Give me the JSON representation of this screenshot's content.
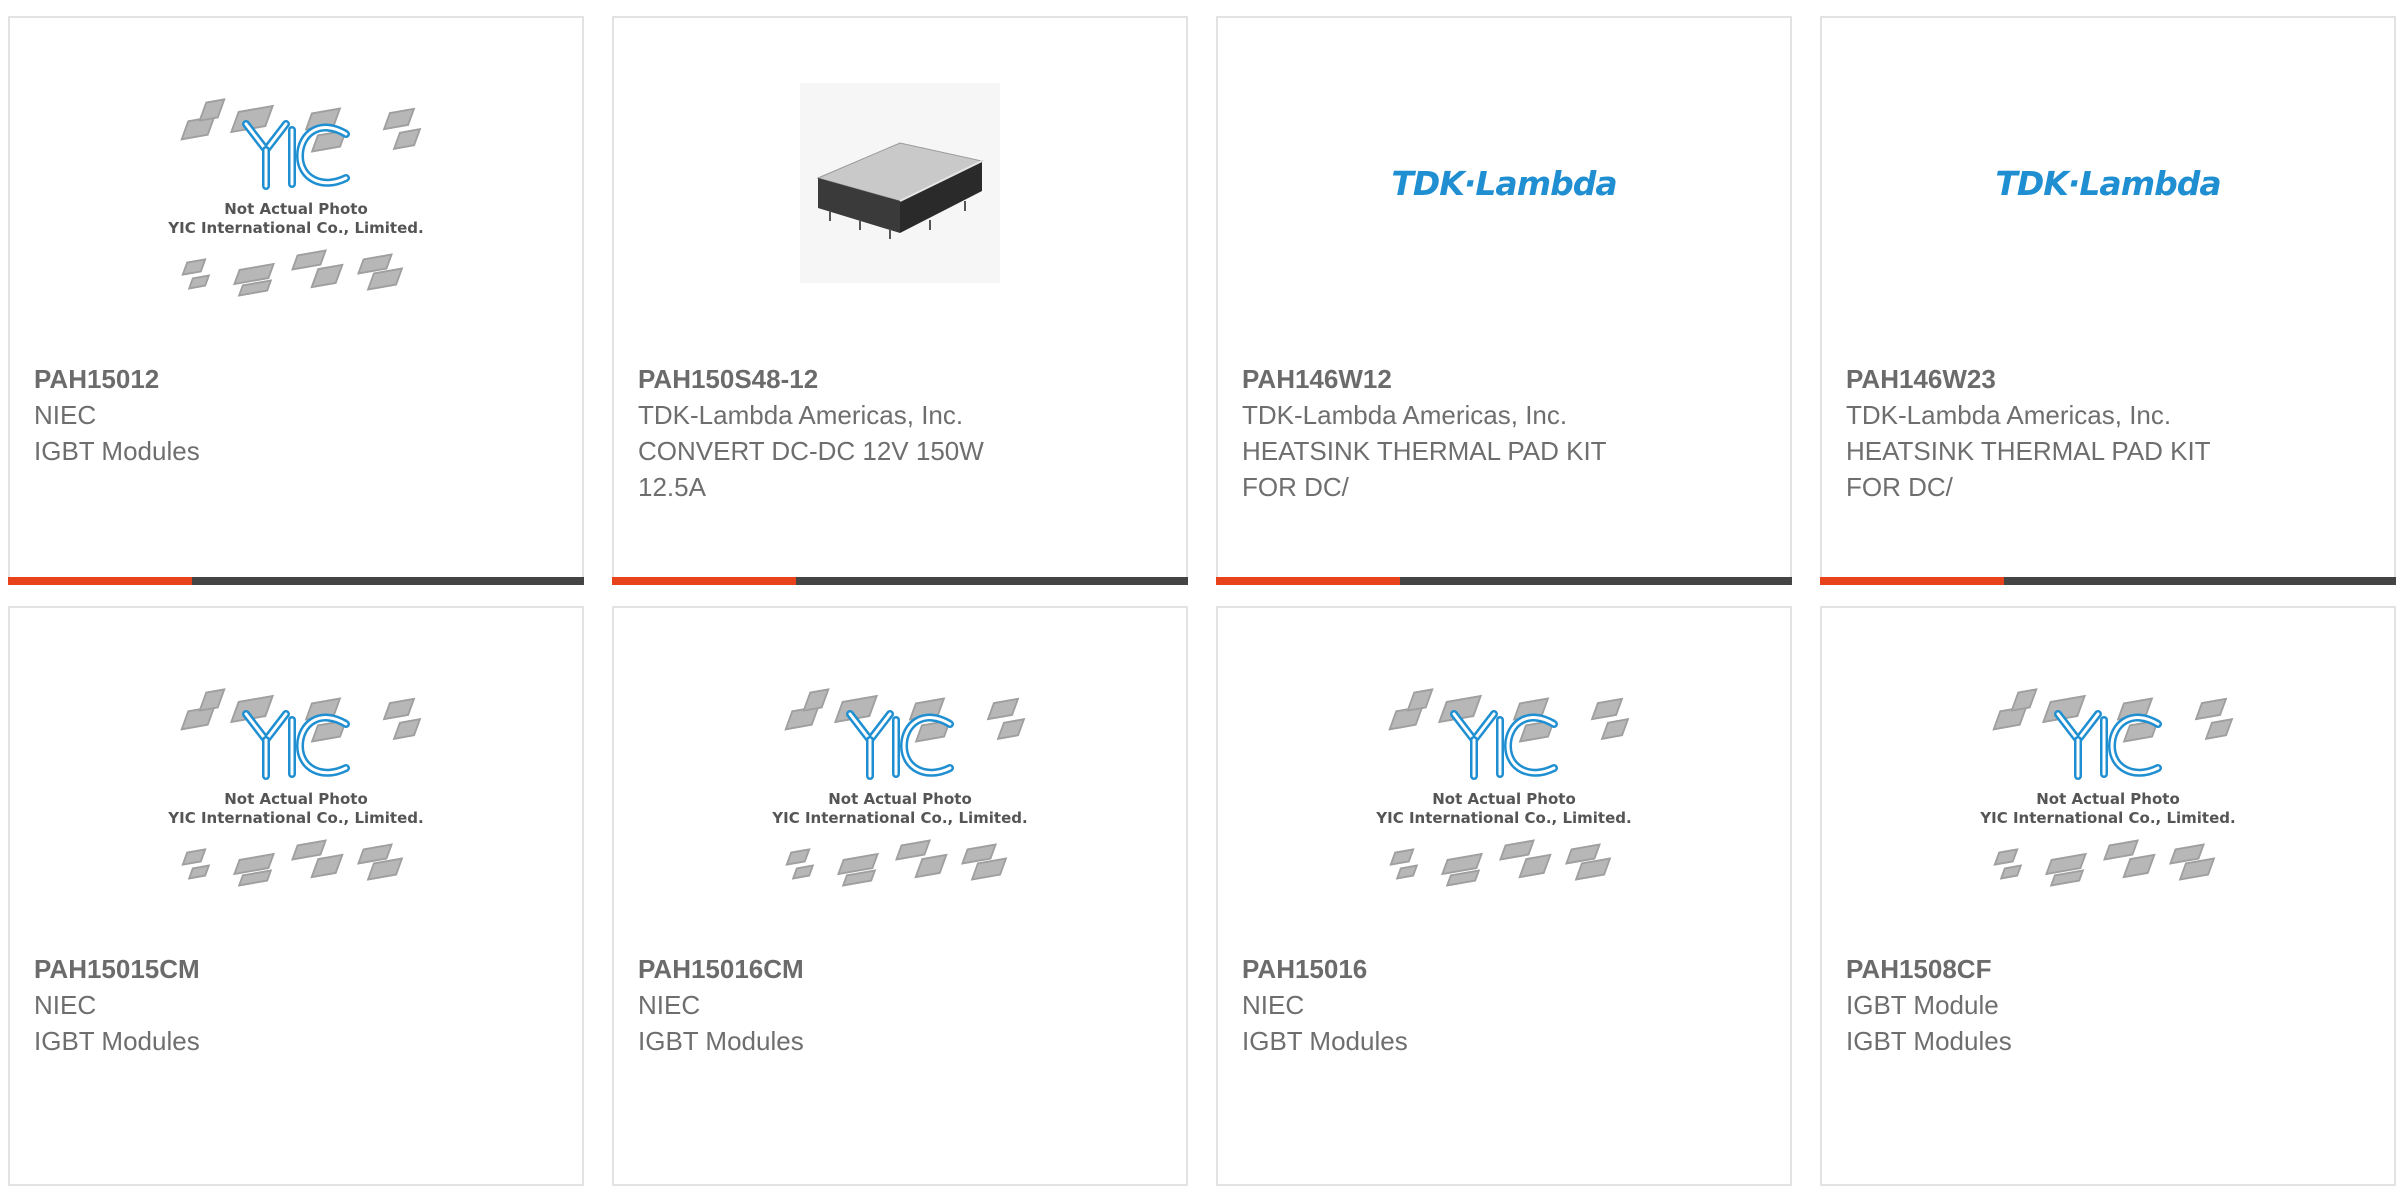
{
  "placeholder": {
    "caption1": "Not Actual Photo",
    "caption2": "YIC International Co., Limited.",
    "logo": "YIC"
  },
  "brand_logo_text": "TDK·Lambda",
  "colors": {
    "accent": "#e8421c",
    "bar": "#444444",
    "logo_blue": "#1f8fd2"
  },
  "products": [
    {
      "part": "PAH15012",
      "line1": "NIEC",
      "line2": "IGBT Modules",
      "line3": "",
      "image": "placeholder"
    },
    {
      "part": "PAH150S48-12",
      "line1": "TDK-Lambda Americas, Inc.",
      "line2": "CONVERT DC-DC 12V 150W",
      "line3": "12.5A",
      "image": "module-photo"
    },
    {
      "part": "PAH146W12",
      "line1": "TDK-Lambda Americas, Inc.",
      "line2": "HEATSINK THERMAL PAD KIT",
      "line3": "FOR DC/",
      "image": "brand-logo"
    },
    {
      "part": "PAH146W23",
      "line1": "TDK-Lambda Americas, Inc.",
      "line2": "HEATSINK THERMAL PAD KIT",
      "line3": "FOR DC/",
      "image": "brand-logo"
    },
    {
      "part": "PAH15015CM",
      "line1": "NIEC",
      "line2": "IGBT Modules",
      "line3": "",
      "image": "placeholder"
    },
    {
      "part": "PAH15016CM",
      "line1": "NIEC",
      "line2": "IGBT Modules",
      "line3": "",
      "image": "placeholder"
    },
    {
      "part": "PAH15016",
      "line1": "NIEC",
      "line2": "IGBT Modules",
      "line3": "",
      "image": "placeholder"
    },
    {
      "part": "PAH1508CF",
      "line1": "IGBT Module",
      "line2": "IGBT Modules",
      "line3": "",
      "image": "placeholder"
    }
  ]
}
